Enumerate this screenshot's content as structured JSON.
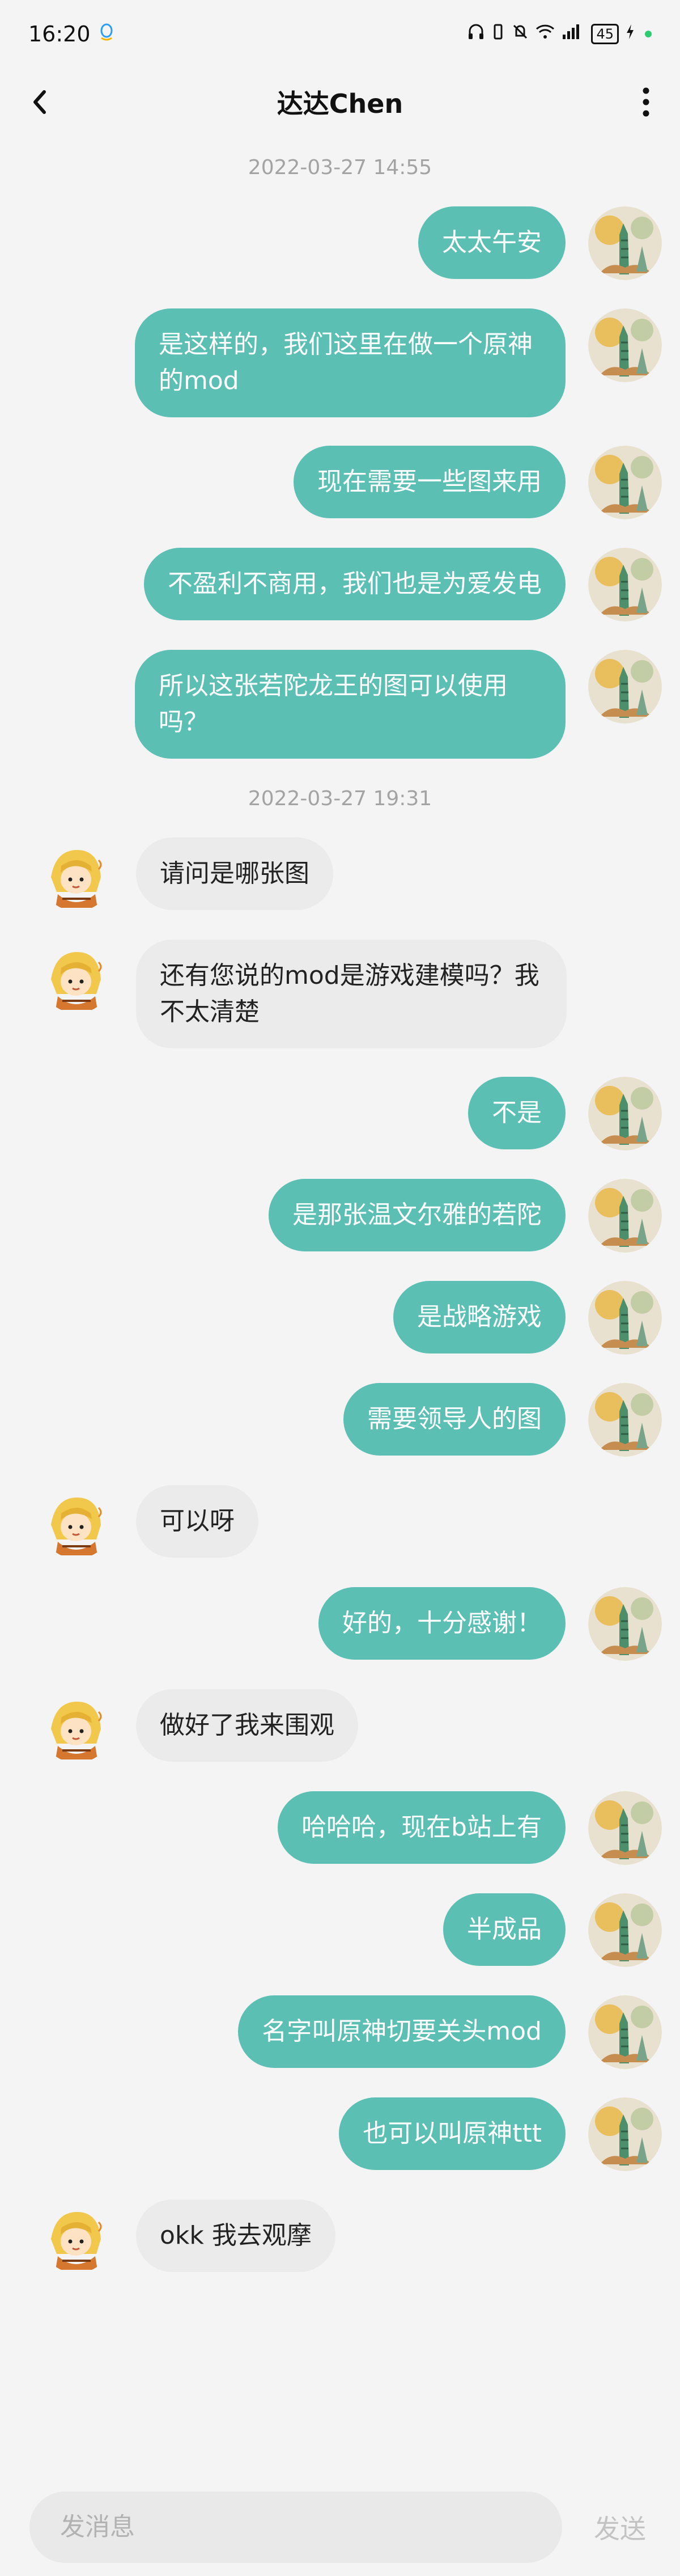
{
  "status": {
    "time": "16:20",
    "battery": "45",
    "network": "5G"
  },
  "header": {
    "title": "达达Chen"
  },
  "messages": [
    {
      "type": "timestamp",
      "text": "2022-03-27 14:55"
    },
    {
      "type": "msg",
      "side": "right",
      "text": "太太午安"
    },
    {
      "type": "msg",
      "side": "right",
      "text": "是这样的，我们这里在做一个原神的mod"
    },
    {
      "type": "msg",
      "side": "right",
      "text": "现在需要一些图来用"
    },
    {
      "type": "msg",
      "side": "right",
      "text": "不盈利不商用，我们也是为爱发电"
    },
    {
      "type": "msg",
      "side": "right",
      "text": "所以这张若陀龙王的图可以使用吗？"
    },
    {
      "type": "timestamp",
      "text": "2022-03-27 19:31"
    },
    {
      "type": "msg",
      "side": "left",
      "text": "请问是哪张图"
    },
    {
      "type": "msg",
      "side": "left",
      "text": "还有您说的mod是游戏建模吗？我不太清楚"
    },
    {
      "type": "msg",
      "side": "right",
      "text": "不是"
    },
    {
      "type": "msg",
      "side": "right",
      "text": "是那张温文尔雅的若陀"
    },
    {
      "type": "msg",
      "side": "right",
      "text": "是战略游戏"
    },
    {
      "type": "msg",
      "side": "right",
      "text": "需要领导人的图"
    },
    {
      "type": "msg",
      "side": "left",
      "text": "可以呀"
    },
    {
      "type": "msg",
      "side": "right",
      "text": "好的，十分感谢！"
    },
    {
      "type": "msg",
      "side": "left",
      "text": "做好了我来围观"
    },
    {
      "type": "msg",
      "side": "right",
      "text": "哈哈哈，现在b站上有"
    },
    {
      "type": "msg",
      "side": "right",
      "text": "半成品"
    },
    {
      "type": "msg",
      "side": "right",
      "text": "名字叫原神切要关头mod"
    },
    {
      "type": "msg",
      "side": "right",
      "text": "也可以叫原神ttt"
    },
    {
      "type": "msg",
      "side": "left",
      "text": "okk 我去观摩"
    }
  ],
  "composer": {
    "placeholder": "发消息",
    "send_label": "发送"
  },
  "colors": {
    "accent_bubble": "#5bbfb3",
    "incoming_bubble": "#ebebeb",
    "background": "#f4f4f4"
  }
}
